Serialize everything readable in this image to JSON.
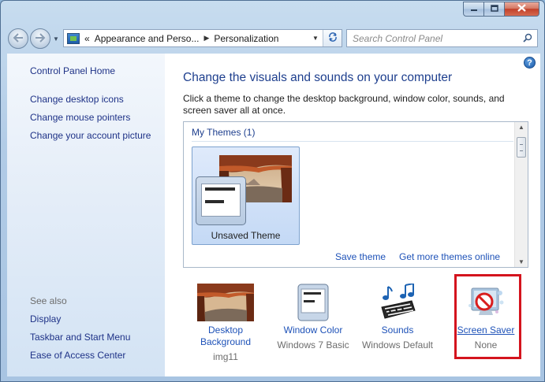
{
  "window": {
    "caption_buttons": [
      "minimize-icon",
      "maximize-icon",
      "close-icon"
    ]
  },
  "nav": {
    "breadcrumb_prefix": "«",
    "breadcrumb": [
      "Appearance and Perso...",
      "Personalization"
    ],
    "search_placeholder": "Search Control Panel"
  },
  "sidebar": {
    "home": "Control Panel Home",
    "links": [
      "Change desktop icons",
      "Change mouse pointers",
      "Change your account picture"
    ],
    "see_also_label": "See also",
    "see_also": [
      "Display",
      "Taskbar and Start Menu",
      "Ease of Access Center"
    ]
  },
  "main": {
    "title": "Change the visuals and sounds on your computer",
    "description": "Click a theme to change the desktop background, window color, sounds, and screen saver all at once.",
    "group_label": "My Themes (1)",
    "theme_name": "Unsaved Theme",
    "save_theme": "Save theme",
    "get_more": "Get more themes online"
  },
  "settings": {
    "background": {
      "label_line1": "Desktop",
      "label_line2": "Background",
      "value": "img11"
    },
    "window_color": {
      "label": "Window Color",
      "value": "Windows 7 Basic"
    },
    "sounds": {
      "label": "Sounds",
      "value": "Windows Default"
    },
    "screen_saver": {
      "label": "Screen Saver",
      "value": "None"
    }
  },
  "colors": {
    "link": "#1e52b8",
    "title": "#1e3f8e",
    "highlight": "#d4141e"
  }
}
